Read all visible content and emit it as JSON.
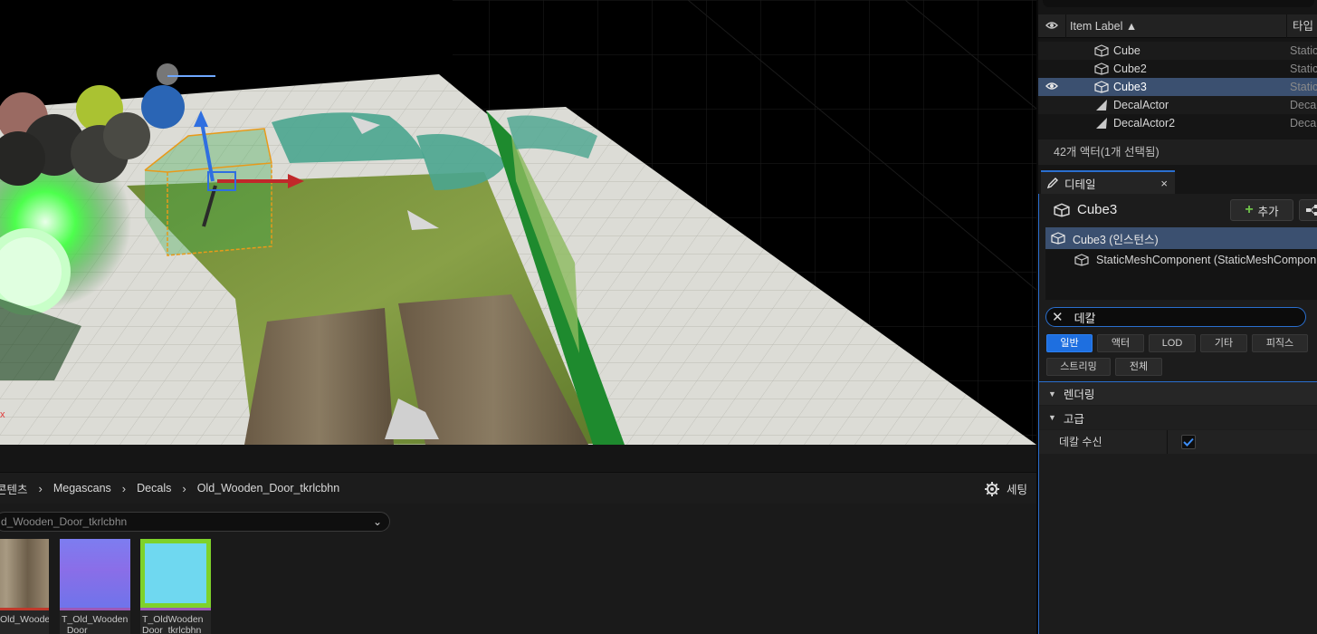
{
  "viewport": {
    "axis_label": "x"
  },
  "outliner": {
    "columns": {
      "label": "Item Label ▲",
      "type": "타입"
    },
    "rows": [
      {
        "name": "Cube",
        "type": "Static",
        "selected": false,
        "icon": "cube-icon"
      },
      {
        "name": "Cube2",
        "type": "Static",
        "selected": false,
        "icon": "cube-icon"
      },
      {
        "name": "Cube3",
        "type": "Static",
        "selected": true,
        "icon": "cube-icon"
      },
      {
        "name": "DecalActor",
        "type": "Deca",
        "selected": false,
        "icon": "decal-icon"
      },
      {
        "name": "DecalActor2",
        "type": "Deca",
        "selected": false,
        "icon": "decal-icon"
      }
    ],
    "footer": "42개 액터(1개 선택됨)"
  },
  "details": {
    "tab_label": "디테일",
    "actor_name": "Cube3",
    "add_label": "추가",
    "components": [
      {
        "label": "Cube3 (인스턴스)"
      },
      {
        "label": "StaticMeshComponent (StaticMeshCompon"
      }
    ],
    "search_value": "데칼",
    "filters_row1": [
      "일반",
      "액터",
      "LOD",
      "기타",
      "피직스"
    ],
    "filters_row2": [
      "스트리밍",
      "전체"
    ],
    "active_filter": "일반",
    "section": "렌더링",
    "subsection": "고급",
    "property": {
      "name": "데칼 수신",
      "checked": true
    }
  },
  "content_browser": {
    "breadcrumb": [
      "콘텐츠",
      "Megascans",
      "Decals",
      "Old_Wooden_Door_tkrlcbhn"
    ],
    "settings_label": "세팅",
    "path_value": "d_Wooden_Door_tkrlcbhn",
    "assets": [
      {
        "line1": "Old_Wooden",
        "line2": "_",
        "bar": "#c0392b"
      },
      {
        "line1": "T_Old_Wooden",
        "line2": "_Door_",
        "bar": "#9b59b6"
      },
      {
        "line1": "T_OldWooden",
        "line2": "Door_tkrlcbhn",
        "bar": "#9b59b6"
      }
    ]
  },
  "colors": {
    "accent_blue": "#2a6fcf",
    "selected_row": "#3b5070",
    "active_chip": "#1e6fe0",
    "add_plus": "#6fc24a"
  }
}
